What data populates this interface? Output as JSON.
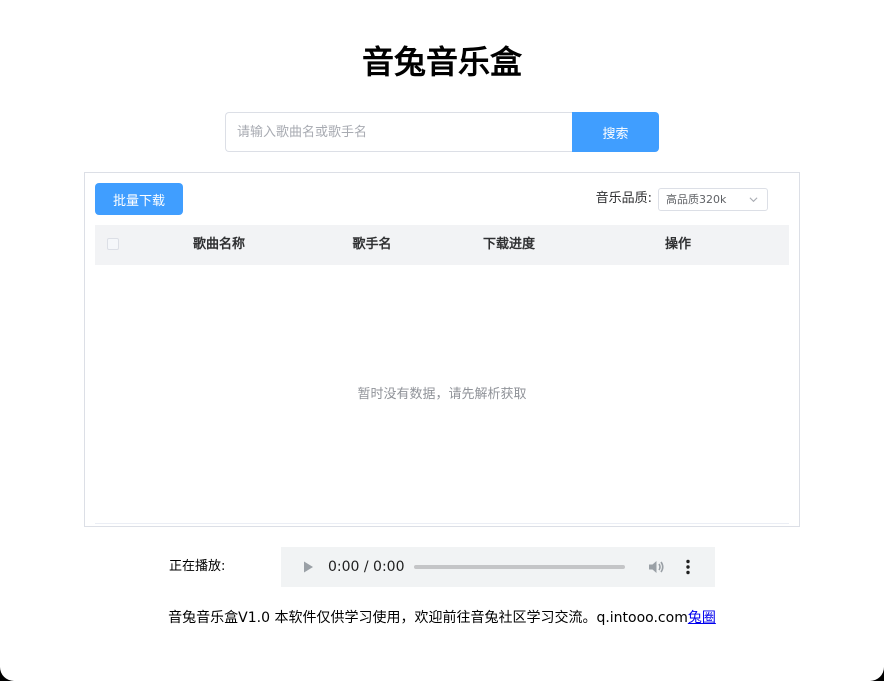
{
  "app": {
    "title": "音兔音乐盒"
  },
  "search": {
    "placeholder": "请输入歌曲名或歌手名",
    "value": "",
    "button_label": "搜索"
  },
  "toolbar": {
    "batch_download_label": "批量下载",
    "quality_label": "音乐品质:",
    "quality_selected": "高品质320k"
  },
  "table": {
    "columns": [
      "歌曲名称",
      "歌手名",
      "下载进度",
      "操作"
    ],
    "rows": [],
    "empty_text": "暂时没有数据，请先解析获取"
  },
  "player": {
    "now_playing_label": "正在播放:",
    "time": "0:00 / 0:00",
    "progress": 0
  },
  "footer": {
    "text": "音兔音乐盒V1.0 本软件仅供学习使用，欢迎前往音兔社区学习交流。q.intooo.com",
    "link_text": "兔圈"
  },
  "colors": {
    "primary": "#409eff",
    "header_bg": "#f2f3f5",
    "border": "#dcdfe6",
    "empty_text": "#909399"
  },
  "icons": {
    "select_arrow": "chevron-down-icon",
    "play": "play-icon",
    "volume": "volume-icon",
    "menu": "more-vertical-icon"
  }
}
